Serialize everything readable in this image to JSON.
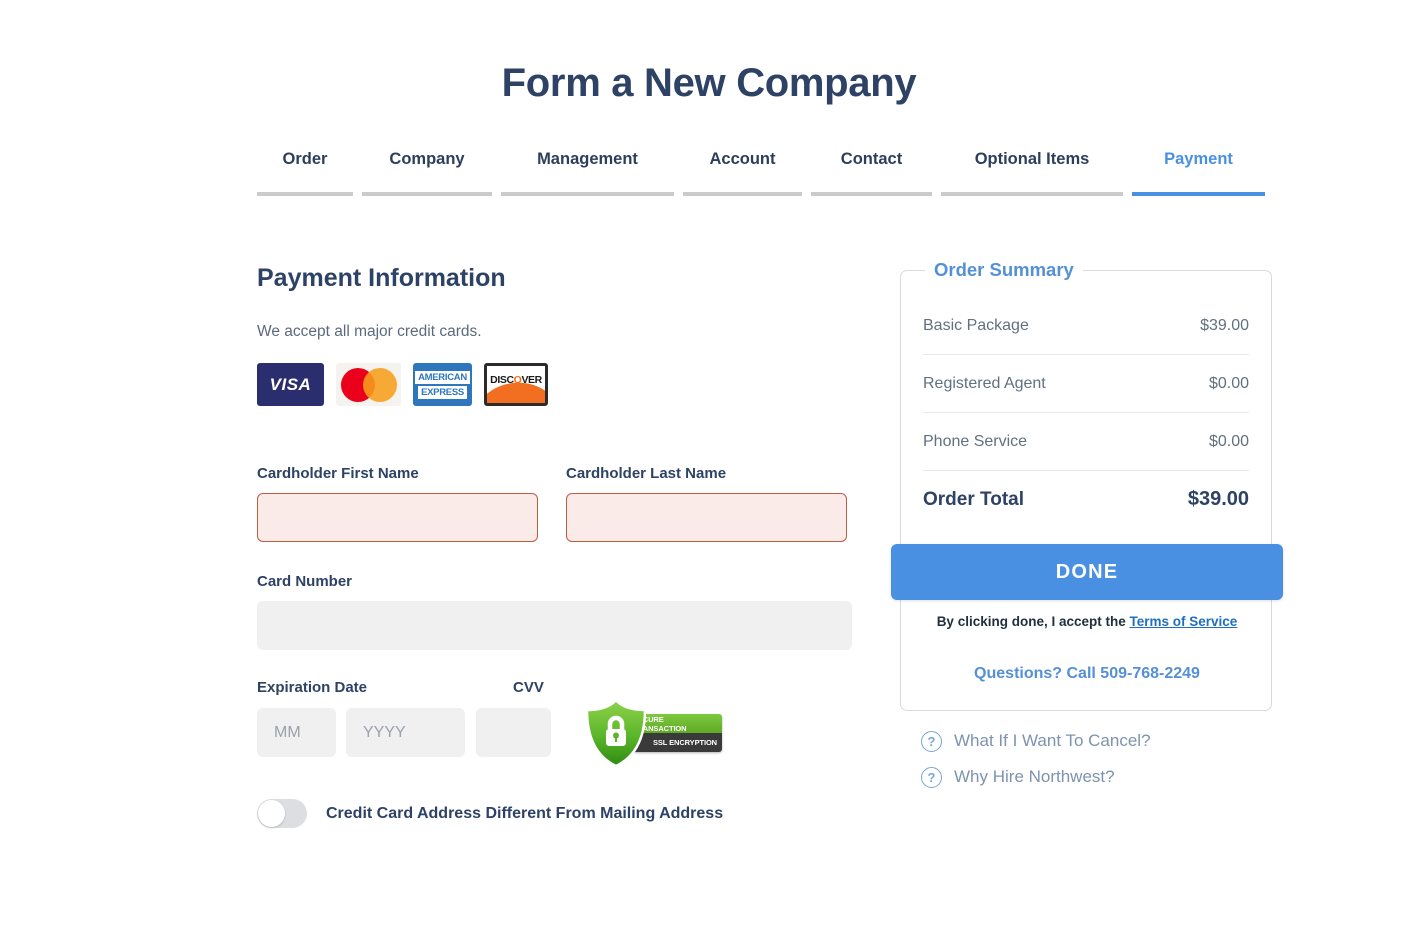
{
  "page": {
    "title": "Form a New Company"
  },
  "tabs": [
    {
      "label": "Order",
      "active": false
    },
    {
      "label": "Company",
      "active": false
    },
    {
      "label": "Management",
      "active": false
    },
    {
      "label": "Account",
      "active": false
    },
    {
      "label": "Contact",
      "active": false
    },
    {
      "label": "Optional Items",
      "active": false
    },
    {
      "label": "Payment",
      "active": true
    }
  ],
  "payment": {
    "section_title": "Payment Information",
    "accept_text": "We accept all major credit cards.",
    "card_logos": [
      {
        "name": "visa-logo",
        "text": "VISA"
      },
      {
        "name": "mastercard-logo",
        "text": ""
      },
      {
        "name": "amex-logo",
        "line1": "AMERICAN",
        "line2": "EXPRESS"
      },
      {
        "name": "discover-logo",
        "pre": "DISC",
        "o": "O",
        "post": "VER"
      }
    ],
    "fields": {
      "first_name_label": "Cardholder First Name",
      "first_name_value": "",
      "first_name_placeholder": "",
      "last_name_label": "Cardholder Last Name",
      "last_name_value": "",
      "last_name_placeholder": "",
      "card_number_label": "Card Number",
      "card_number_value": "",
      "card_number_placeholder": "",
      "expiration_label": "Expiration Date",
      "exp_month_value": "",
      "exp_month_placeholder": "MM",
      "exp_year_value": "",
      "exp_year_placeholder": "YYYY",
      "cvv_label": "CVV",
      "cvv_value": "",
      "cvv_placeholder": ""
    },
    "security_badge": {
      "line1": "SECURE TRANSACTION",
      "line2": "SSL ENCRYPTION"
    },
    "toggle": {
      "label": "Credit Card Address Different From Mailing Address",
      "state": "off"
    }
  },
  "order_summary": {
    "legend": "Order Summary",
    "items": [
      {
        "name": "Basic Package",
        "price": "$39.00"
      },
      {
        "name": "Registered Agent",
        "price": "$0.00"
      },
      {
        "name": "Phone Service",
        "price": "$0.00"
      }
    ],
    "total_label": "Order Total",
    "total_value": "$39.00",
    "done_label": "DONE",
    "tos_prefix": "By clicking done, I accept the ",
    "tos_link": "Terms of Service",
    "questions": "Questions? Call 509-768-2249"
  },
  "help_links": [
    {
      "icon": "question-mark-icon",
      "label": "What If I Want To Cancel?"
    },
    {
      "icon": "question-mark-icon",
      "label": "Why Hire Northwest?"
    }
  ],
  "colors": {
    "title_navy": "#2d4265",
    "accent_blue": "#4a90e2",
    "legend_blue": "#5490d6",
    "tab_inactive_underline": "#c9cbcd",
    "input_grey": "#f0f0f0",
    "error_bg": "#fbebe8",
    "error_border": "#c05b44",
    "help_text": "#7d93ae"
  }
}
